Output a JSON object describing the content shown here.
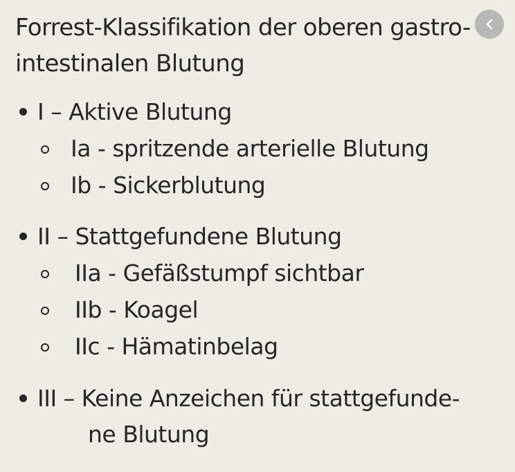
{
  "title": {
    "line1": "Forrest-Klassifikation der oberen gastro-",
    "line2": "intestinalen Blutung"
  },
  "back_icon": "chevron-left-icon",
  "items": [
    {
      "label": "I – Aktive Blutung",
      "sub": [
        "Ia - spritzende arterielle Blutung",
        "Ib - Sickerblutung"
      ]
    },
    {
      "label": "II – Stattgefundene Blutung",
      "sub": [
        "IIa - Gefäßstumpf sichtbar",
        "IIb - Koagel",
        "IIc - Hämatinbelag"
      ]
    },
    {
      "label": "III – Keine Anzeichen für stattgefunde-",
      "label_cont": "ne Blutung",
      "sub": []
    }
  ]
}
